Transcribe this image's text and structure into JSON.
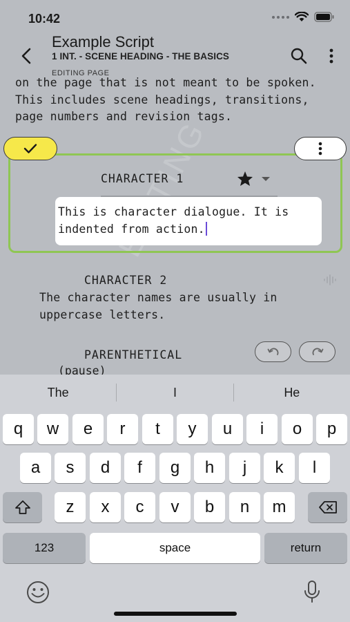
{
  "status_bar": {
    "time": "10:42"
  },
  "header": {
    "title": "Example Script",
    "subtitle": "1 INT. - SCENE HEADING - THE BASICS",
    "editing_label": "EDITING PAGE"
  },
  "script": {
    "action_text": "on the page that is not meant to be spoken. This includes scene headings, transitions, page numbers and revision tags.",
    "watermark": "EDITING",
    "editing_block": {
      "character": "CHARACTER 1",
      "dialogue": "This is character dialogue. It is indented from action."
    },
    "character2": {
      "name": "CHARACTER 2",
      "dialogue": "The character names are usually in uppercase letters."
    },
    "parenthetical": {
      "name": "PARENTHETICAL",
      "text": "(pause)"
    }
  },
  "keyboard": {
    "suggestions": [
      "The",
      "I",
      "He"
    ],
    "row1": [
      "q",
      "w",
      "e",
      "r",
      "t",
      "y",
      "u",
      "i",
      "o",
      "p"
    ],
    "row2": [
      "a",
      "s",
      "d",
      "f",
      "g",
      "h",
      "j",
      "k",
      "l"
    ],
    "row3": [
      "z",
      "x",
      "c",
      "v",
      "b",
      "n",
      "m"
    ],
    "numbers_label": "123",
    "space_label": "space",
    "return_label": "return"
  },
  "colors": {
    "highlight_border": "#8fc653",
    "confirm_button": "#f6e84a",
    "caret": "#6a4bd8"
  }
}
